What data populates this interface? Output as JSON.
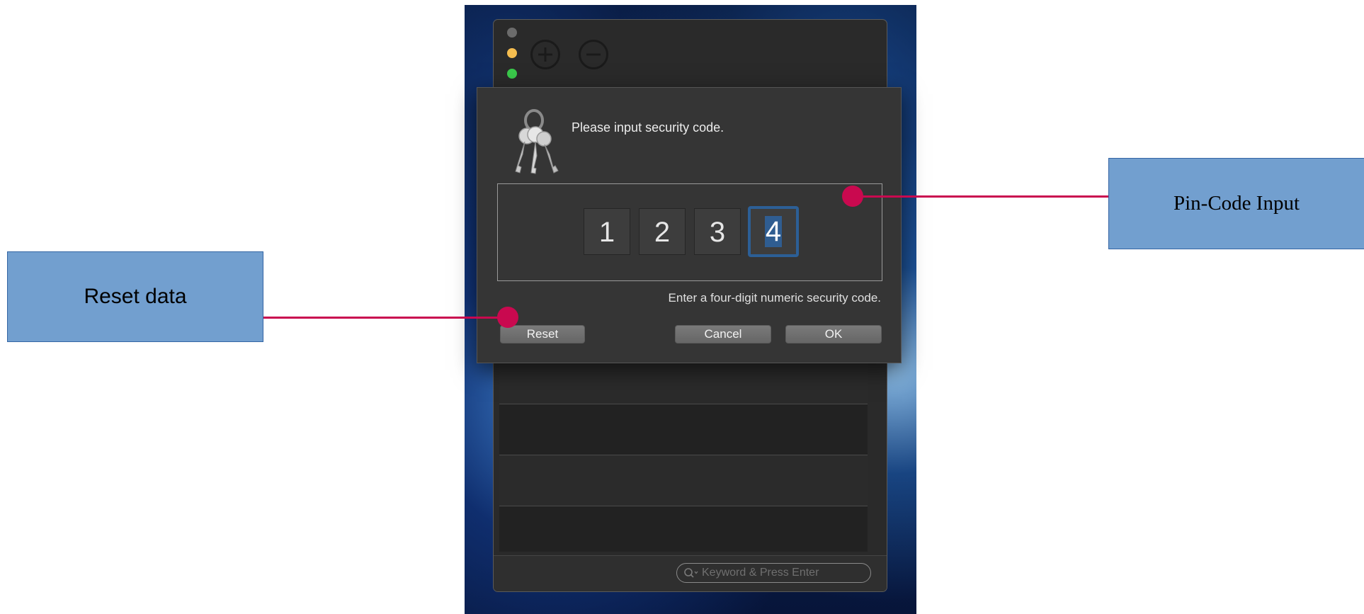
{
  "dialog": {
    "title": "Please input security code.",
    "pin_digits": [
      "1",
      "2",
      "3",
      "4"
    ],
    "hint": "Enter a four-digit numeric security code.",
    "buttons": {
      "reset": "Reset",
      "cancel": "Cancel",
      "ok": "OK"
    },
    "icon": "keys-icon"
  },
  "window": {
    "toolbar_icons": [
      "plus-circle-icon",
      "minus-circle-icon"
    ],
    "search": {
      "placeholder": "Keyword & Press Enter",
      "icon": "search-icon"
    }
  },
  "annotations": {
    "reset_label": "Reset data",
    "pin_label": "Pin-Code Input",
    "color": "#c9094f",
    "box_color": "#729fcf"
  }
}
